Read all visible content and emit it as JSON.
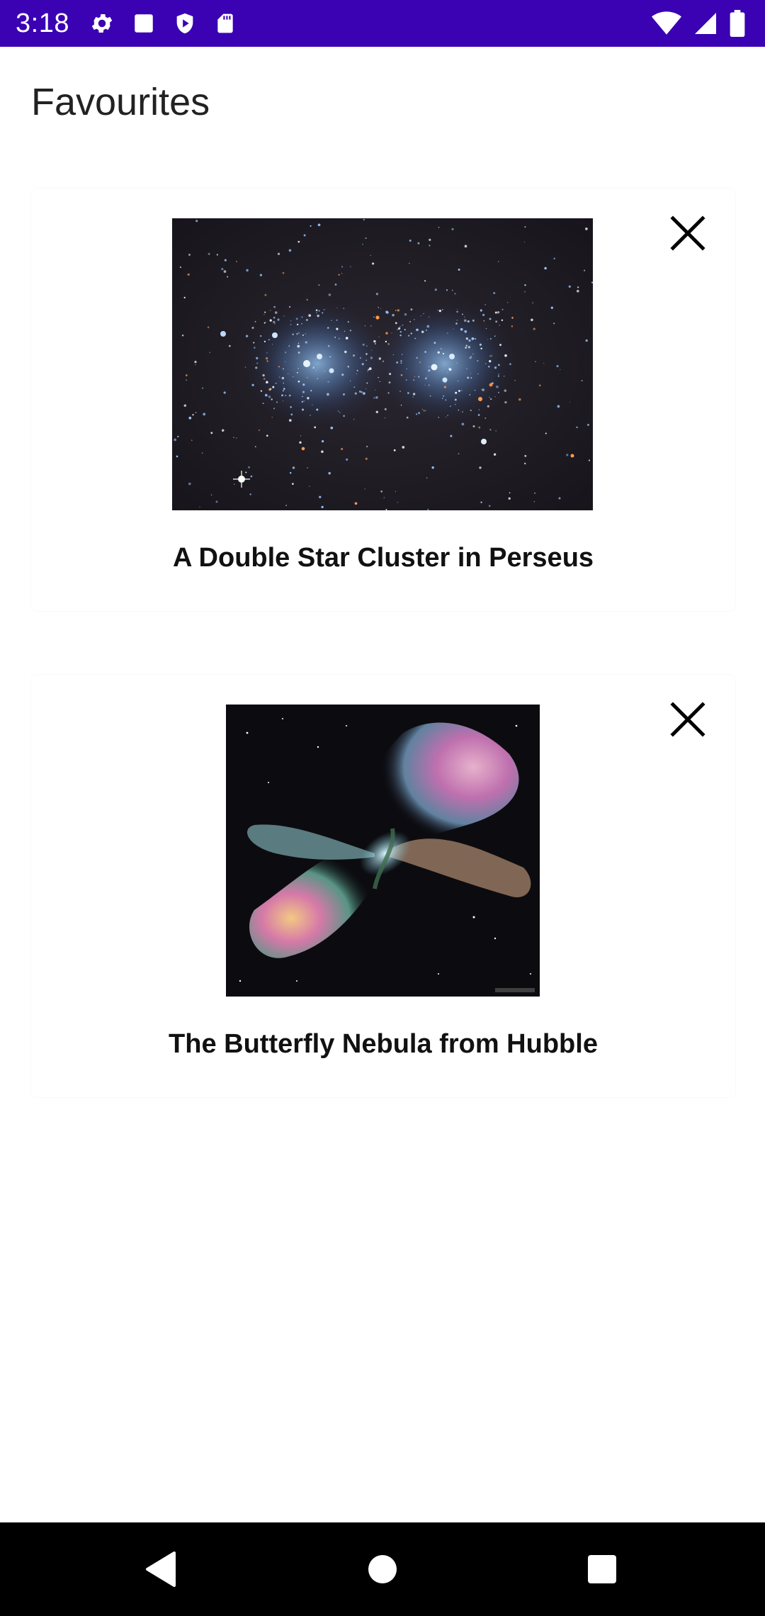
{
  "status_bar": {
    "time": "3:18",
    "background": "#3a02b3",
    "left_icons": [
      "settings-icon",
      "square-notification-icon",
      "shield-play-icon",
      "sd-card-icon"
    ],
    "right_icons": [
      "wifi-icon",
      "cellular-signal-icon",
      "battery-icon"
    ]
  },
  "page": {
    "title": "Favourites"
  },
  "favourites": [
    {
      "title": "A Double Star Cluster in Perseus",
      "image": "star-cluster-image",
      "remove_icon": "close-icon"
    },
    {
      "title": "The Butterfly Nebula from Hubble",
      "image": "butterfly-nebula-image",
      "remove_icon": "close-icon"
    }
  ],
  "nav_bar": {
    "buttons": [
      "back-icon",
      "home-icon",
      "recents-icon"
    ]
  }
}
